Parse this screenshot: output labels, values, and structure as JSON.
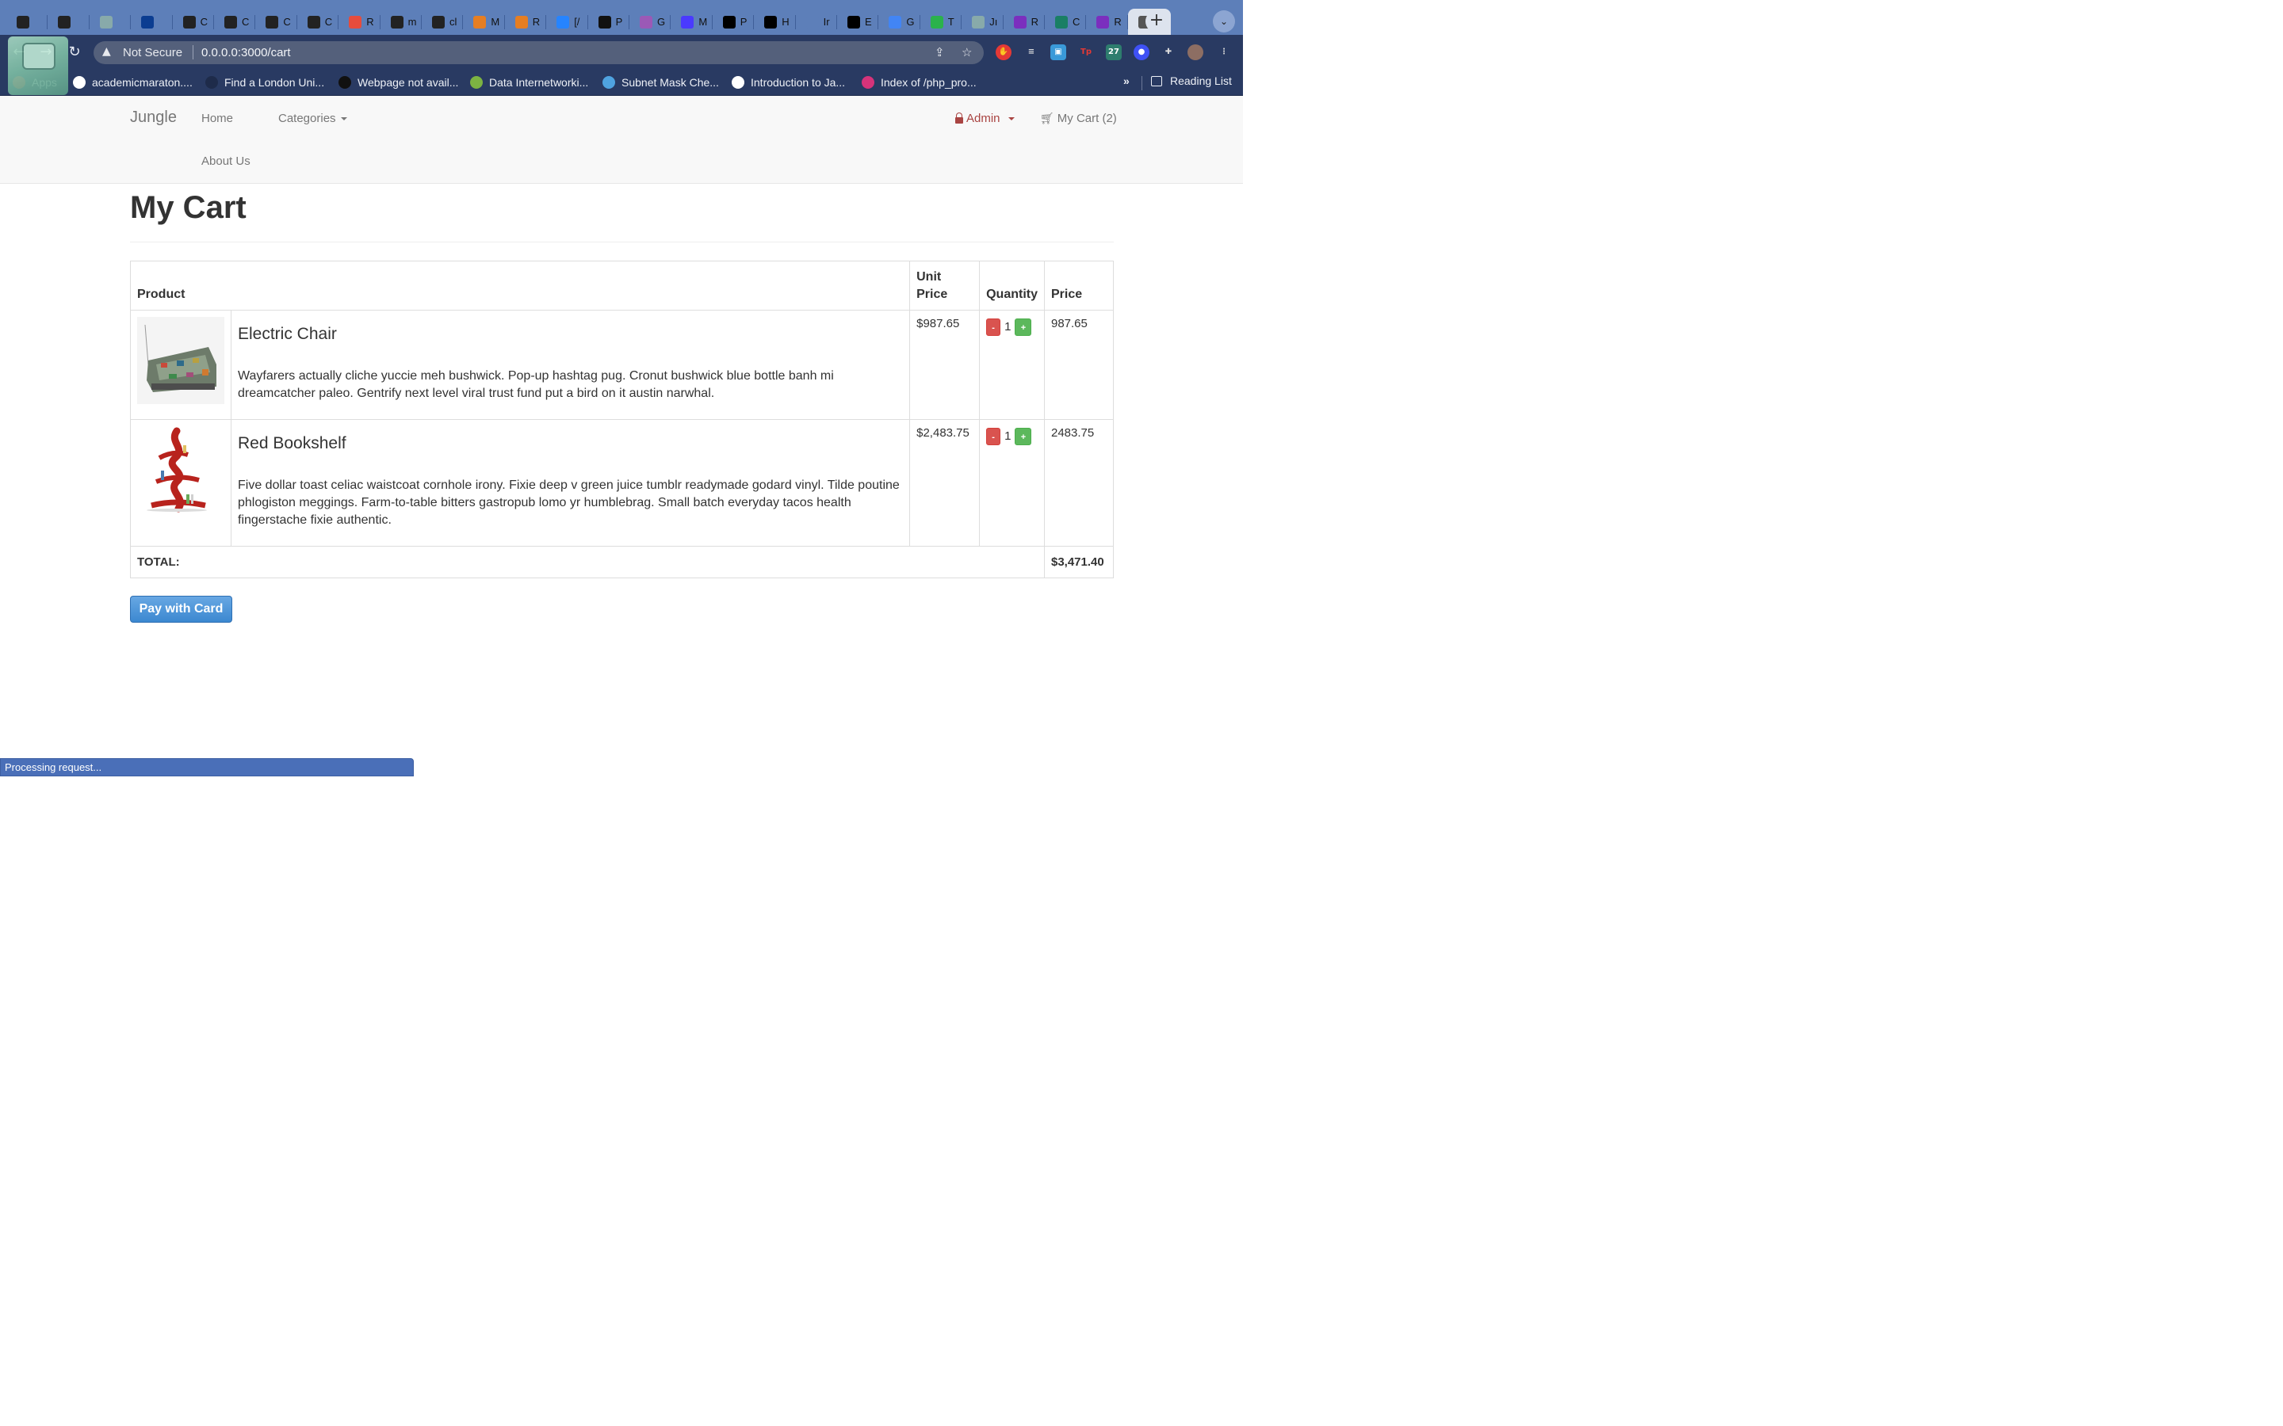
{
  "browser": {
    "tabs": [
      {
        "label": "",
        "icon": "github-icon",
        "color": "#222"
      },
      {
        "label": "",
        "icon": "github-icon",
        "color": "#222"
      },
      {
        "label": "",
        "icon": "globe-icon",
        "color": "#8aa"
      },
      {
        "label": "",
        "icon": "nasa-icon",
        "color": "#0b3d91"
      },
      {
        "label": "C",
        "icon": "plus-circle-icon",
        "color": "#222"
      },
      {
        "label": "C",
        "icon": "plus-circle-icon",
        "color": "#222"
      },
      {
        "label": "C",
        "icon": "plus-circle-icon",
        "color": "#222"
      },
      {
        "label": "C",
        "icon": "plus-circle-icon",
        "color": "#222"
      },
      {
        "label": "R",
        "icon": "r-logo-icon",
        "color": "#e74c3c"
      },
      {
        "label": "m",
        "icon": "github-icon",
        "color": "#222"
      },
      {
        "label": "cl",
        "icon": "github-icon",
        "color": "#222"
      },
      {
        "label": "M",
        "icon": "bars-icon",
        "color": "#e67e22"
      },
      {
        "label": "R",
        "icon": "bars-icon",
        "color": "#e67e22"
      },
      {
        "label": "[/",
        "icon": "jira-icon",
        "color": "#2684ff"
      },
      {
        "label": "P",
        "icon": "wix-icon",
        "color": "#111"
      },
      {
        "label": "G",
        "icon": "pin-icon",
        "color": "#9b59b6"
      },
      {
        "label": "M",
        "icon": "w-icon",
        "color": "#4a3aff"
      },
      {
        "label": "P",
        "icon": "x-icon",
        "color": "#000"
      },
      {
        "label": "H",
        "icon": "oo-icon",
        "color": "#000"
      },
      {
        "label": "Ir",
        "icon": "blank-icon",
        "color": "#5d7fb9"
      },
      {
        "label": "E",
        "icon": "x-icon",
        "color": "#000"
      },
      {
        "label": "G",
        "icon": "docs-icon",
        "color": "#4285f4"
      },
      {
        "label": "T",
        "icon": "td-icon",
        "color": "#2bb24c"
      },
      {
        "label": "Jı",
        "icon": "globe-icon",
        "color": "#8aa"
      },
      {
        "label": "R",
        "icon": "chrome-ext-icon",
        "color": "#7b2fbe"
      },
      {
        "label": "C",
        "icon": "c-icon",
        "color": "#1a7f64"
      },
      {
        "label": "R",
        "icon": "chrome-ext-icon",
        "color": "#7b2fbe"
      },
      {
        "label": "R",
        "icon": "globe-icon",
        "color": "#555",
        "active": true
      }
    ],
    "address": {
      "security_label": "Not Secure",
      "url": "0.0.0.0:3000/cart"
    },
    "bookmarks": [
      {
        "label": "Apps",
        "color": "#e74c3c"
      },
      {
        "label": "academicmaraton....",
        "color": "#ffffff"
      },
      {
        "label": "Find a London Uni...",
        "color": "#1e2b4a"
      },
      {
        "label": "Webpage not avail...",
        "color": "#111111"
      },
      {
        "label": "Data Internetworki...",
        "color": "#7cb342"
      },
      {
        "label": "Subnet Mask Che...",
        "color": "#4fa3e0"
      },
      {
        "label": "Introduction to Ja...",
        "color": "#ffffff"
      },
      {
        "label": "Index of /php_pro...",
        "color": "#d6337a"
      }
    ],
    "bookmarks_more": "»",
    "reading_list": "Reading List"
  },
  "site": {
    "brand": "Jungle",
    "nav": {
      "home": "Home",
      "categories": "Categories",
      "about": "About Us",
      "admin": "Admin",
      "cart": "My Cart (2)"
    }
  },
  "page": {
    "title": "My Cart",
    "table": {
      "headers": {
        "product": "Product",
        "unit_price": "Unit Price",
        "quantity": "Quantity",
        "price": "Price"
      },
      "items": [
        {
          "name": "Electric Chair",
          "description": "Wayfarers actually cliche yuccie meh bushwick. Pop-up hashtag pug. Cronut bushwick blue bottle banh mi dreamcatcher paleo. Gentrify next level viral trust fund put a bird on it austin narwhal.",
          "unit_price": "$987.65",
          "quantity": "1",
          "price": "987.65",
          "minus": "-",
          "plus": "+"
        },
        {
          "name": "Red Bookshelf",
          "description": "Five dollar toast celiac waistcoat cornhole irony. Fixie deep v green juice tumblr readymade godard vinyl. Tilde poutine phlogiston meggings. Farm-to-table bitters gastropub lomo yr humblebrag. Small batch everyday tacos health fingerstache fixie authentic.",
          "unit_price": "$2,483.75",
          "quantity": "1",
          "price": "2483.75",
          "minus": "-",
          "plus": "+"
        }
      ],
      "total_label": "TOTAL:",
      "total_value": "$3,471.40"
    },
    "pay_button": "Pay with Card"
  },
  "status": "Processing request...",
  "colors": {
    "danger": "#d9534f",
    "success": "#5cb85c",
    "primary": "#428bca",
    "admin": "#a94442"
  }
}
